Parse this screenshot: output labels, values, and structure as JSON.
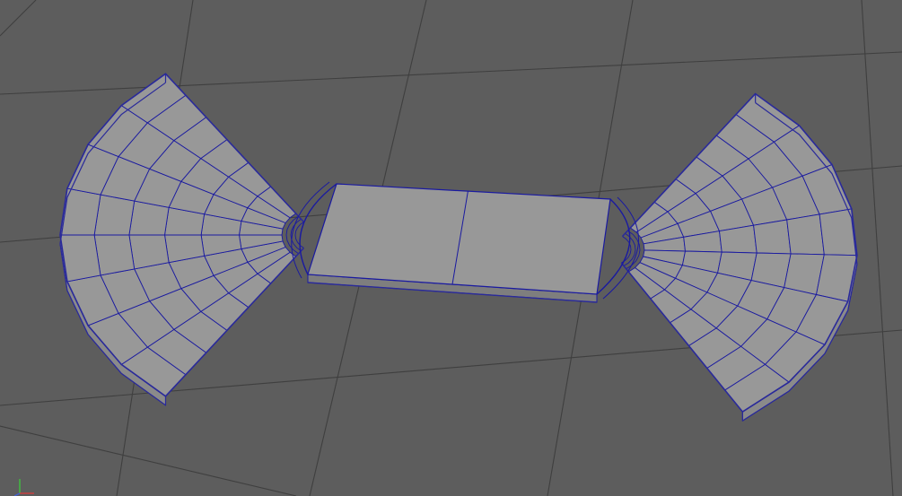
{
  "viewport": {
    "background_color": "#5d5d5d",
    "grid_color": "#3f3f3f",
    "mesh_fill_color": "#989898",
    "mesh_side_color": "#8a8a8a",
    "mesh_shadow_color": "#7e7e7e",
    "wireframe_color": "#1a1aa0",
    "selection_outline_color": "#2a2a9a"
  },
  "axis_gizmo": {
    "icon": "xyz-axis-icon",
    "x_color": "#d04040",
    "y_color": "#40c040",
    "z_color": "#4060d0"
  }
}
